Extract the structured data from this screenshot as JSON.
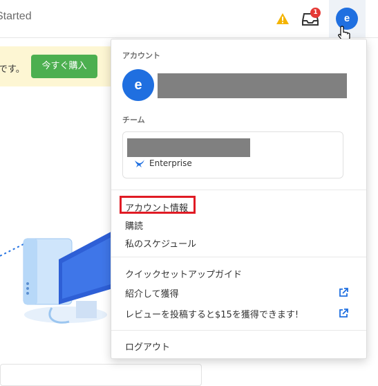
{
  "header": {
    "title": "Started",
    "inbox_badge": "1",
    "avatar_initial": "e"
  },
  "banner": {
    "text": "です。",
    "buy_button": "今すぐ購入"
  },
  "dropdown": {
    "account_label": "アカウント",
    "account_avatar": "e",
    "team_label": "チーム",
    "team_plan": "Enterprise",
    "menu": {
      "account_info": "アカウント情報",
      "subscription": "購読",
      "my_schedule": "私のスケジュール",
      "quick_setup": "クイックセットアップガイド",
      "referral": "紹介して獲得",
      "review": "レビューを投稿すると$15を獲得できます!",
      "logout": "ログアウト"
    }
  },
  "colors": {
    "accent": "#1f6fe0",
    "buy_button": "#4caf50",
    "highlight": "#e01b24",
    "badge": "#e53935",
    "warning": "#f4b400"
  }
}
